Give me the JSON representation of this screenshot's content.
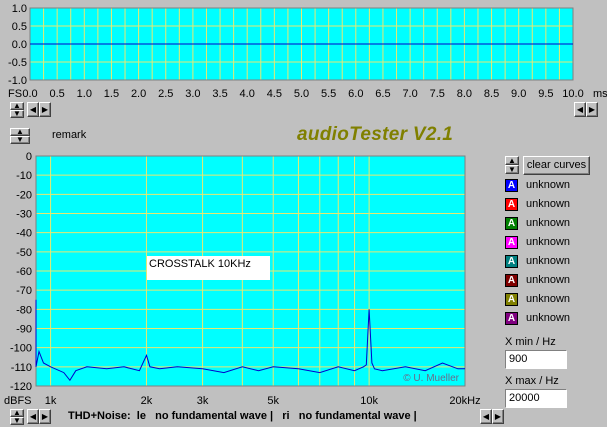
{
  "scope": {
    "y_ticks": [
      "1.0",
      "0.5",
      "0.0",
      "-0.5",
      "-1.0"
    ],
    "y_unit": "FS",
    "x_ticks": [
      "0.0",
      "0.5",
      "1.0",
      "1.5",
      "2.0",
      "2.5",
      "3.0",
      "3.5",
      "4.0",
      "4.5",
      "5.0",
      "5.5",
      "6.0",
      "6.5",
      "7.0",
      "7.5",
      "8.0",
      "8.5",
      "9.0",
      "9.5",
      "10.0"
    ],
    "x_unit": "ms",
    "bg_color": "#00ffff",
    "grid_color": "#e8e870"
  },
  "remark_label": "remark",
  "title": "audioTester V2.1",
  "title_color": "#808000",
  "clear_button": "clear curves",
  "curves": [
    {
      "letter": "A",
      "color": "#0000ff",
      "label": "unknown"
    },
    {
      "letter": "A",
      "color": "#ff0000",
      "label": "unknown"
    },
    {
      "letter": "A",
      "color": "#008000",
      "label": "unknown"
    },
    {
      "letter": "A",
      "color": "#ff00ff",
      "label": "unknown"
    },
    {
      "letter": "A",
      "color": "#008080",
      "label": "unknown"
    },
    {
      "letter": "A",
      "color": "#800000",
      "label": "unknown"
    },
    {
      "letter": "A",
      "color": "#808000",
      "label": "unknown"
    },
    {
      "letter": "A",
      "color": "#800080",
      "label": "unknown"
    }
  ],
  "xmin_label": "X min / Hz",
  "xmin_value": "900",
  "xmax_label": "X max / Hz",
  "xmax_value": "20000",
  "spectrum": {
    "y_ticks": [
      "0",
      "-10",
      "-20",
      "-30",
      "-40",
      "-50",
      "-60",
      "-70",
      "-80",
      "-90",
      "-100",
      "-110",
      "-120"
    ],
    "y_unit": "dBFS",
    "x_ticks": [
      "1k",
      "2k",
      "3k",
      "5k",
      "10k",
      "20kHz"
    ],
    "annotation": "CROSSTALK 10KHz",
    "copyright": "© U. Mueller"
  },
  "status": "THD+Noise:  le   no fundamental wave |   ri   no fundamental wave |",
  "chart_data": [
    {
      "type": "line",
      "title": "",
      "xlabel": "ms",
      "ylabel": "FS",
      "xlim": [
        0,
        10
      ],
      "ylim": [
        -1,
        1
      ],
      "grid": true,
      "series": [
        {
          "values_x": [
            0,
            10
          ],
          "values_y": [
            0,
            0
          ]
        }
      ]
    },
    {
      "type": "line",
      "title": "",
      "xlabel": "Hz",
      "ylabel": "dBFS",
      "xscale": "log",
      "xlim": [
        900,
        20000
      ],
      "ylim": [
        -120,
        0
      ],
      "grid": true,
      "series": [
        {
          "x": [
            900,
            920,
            950,
            1000,
            1100,
            1150,
            1200,
            1300,
            1500,
            1700,
            1900,
            2000,
            2050,
            2200,
            2500,
            3000,
            3500,
            4000,
            4500,
            5000,
            6000,
            7000,
            8000,
            9000,
            9600,
            9800,
            10000,
            10200,
            10400,
            11000,
            13000,
            15000,
            17000,
            19000,
            20000
          ],
          "y": [
            -110,
            -102,
            -108,
            -110,
            -113,
            -117,
            -112,
            -110,
            -111,
            -110,
            -112,
            -104,
            -110,
            -111,
            -110,
            -111,
            -113,
            -110,
            -112,
            -110,
            -111,
            -113,
            -110,
            -112,
            -110,
            -109,
            -80,
            -108,
            -111,
            -112,
            -110,
            -112,
            -108,
            -111,
            -111
          ]
        }
      ]
    }
  ]
}
